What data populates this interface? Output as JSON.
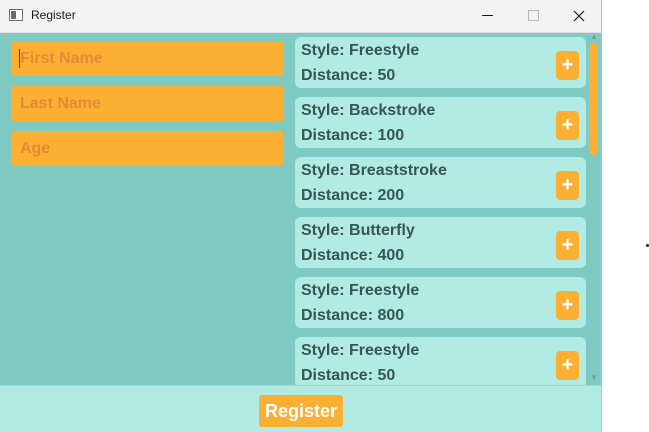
{
  "window": {
    "title": "Register",
    "app_icon": "window-app-icon",
    "controls": [
      "minimize-icon",
      "maximize-icon",
      "close-icon"
    ]
  },
  "form": {
    "first_name_placeholder": "First Name",
    "last_name_placeholder": "Last Name",
    "age_placeholder": "Age"
  },
  "events": [
    {
      "style": "Style: Freestyle",
      "distance": "Distance: 50",
      "add_label": "+"
    },
    {
      "style": "Style: Backstroke",
      "distance": "Distance: 100",
      "add_label": "+"
    },
    {
      "style": "Style: Breaststroke",
      "distance": "Distance: 200",
      "add_label": "+"
    },
    {
      "style": "Style: Butterfly",
      "distance": "Distance: 400",
      "add_label": "+"
    },
    {
      "style": "Style: Freestyle",
      "distance": "Distance: 800",
      "add_label": "+"
    },
    {
      "style": "Style: Freestyle",
      "distance": "Distance: 50",
      "add_label": "+"
    }
  ],
  "footer": {
    "register_label": "Register"
  },
  "colors": {
    "background": "#7fcac2",
    "card": "#b2eae4",
    "accent": "#fbb034",
    "placeholder_text": "#e38b33",
    "card_text": "#375752"
  }
}
